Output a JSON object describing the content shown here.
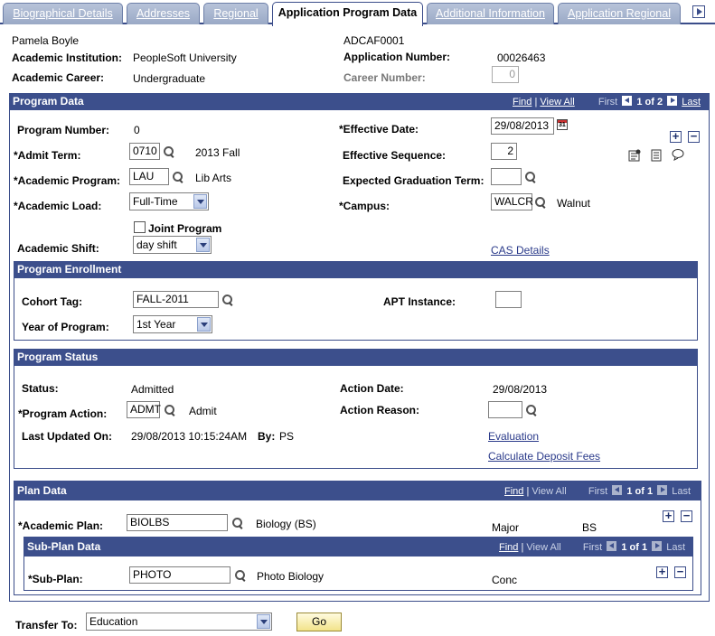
{
  "tabs": [
    {
      "label": "Biographical Details"
    },
    {
      "label": "Addresses"
    },
    {
      "label": "Regional"
    },
    {
      "label": "Application Program Data"
    },
    {
      "label": "Additional Information"
    },
    {
      "label": "Application Regional"
    }
  ],
  "header": {
    "name": "Pamela Boyle",
    "id": "ADCAF0001",
    "institution_label": "Academic Institution:",
    "institution_value": "PeopleSoft University",
    "app_number_label": "Application Number:",
    "app_number_value": "00026463",
    "career_label": "Academic Career:",
    "career_value": "Undergraduate",
    "career_number_label": "Career Number:",
    "career_number_value": "0"
  },
  "program_data": {
    "title": "Program Data",
    "nav": {
      "find": "Find",
      "view_all": "View All",
      "first": "First",
      "count": "1 of 2",
      "last": "Last"
    },
    "program_number_label": "Program Number:",
    "program_number_value": "0",
    "effective_date_label": "*Effective Date:",
    "effective_date_value": "29/08/2013",
    "admit_term_label": "*Admit Term:",
    "admit_term_value": "0710",
    "admit_term_desc": "2013 Fall",
    "effective_seq_label": "Effective Sequence:",
    "effective_seq_value": "2",
    "academic_program_label": "*Academic Program:",
    "academic_program_value": "LAU",
    "academic_program_desc": "Lib Arts",
    "exp_grad_label": "Expected Graduation Term:",
    "exp_grad_value": "",
    "academic_load_label": "*Academic Load:",
    "academic_load_value": "Full-Time",
    "campus_label": "*Campus:",
    "campus_value": "WALCR",
    "campus_desc": "Walnut",
    "joint_program_label": "Joint Program",
    "academic_shift_label": "Academic Shift:",
    "academic_shift_value": "day shift",
    "cas_details": "CAS Details"
  },
  "program_enrollment": {
    "title": "Program Enrollment",
    "cohort_tag_label": "Cohort Tag:",
    "cohort_tag_value": "FALL-2011",
    "apt_label": "APT Instance:",
    "apt_value": "",
    "year_label": "Year of Program:",
    "year_value": "1st Year"
  },
  "program_status": {
    "title": "Program Status",
    "status_label": "Status:",
    "status_value": "Admitted",
    "action_date_label": "Action Date:",
    "action_date_value": "29/08/2013",
    "program_action_label": "*Program Action:",
    "program_action_value": "ADMT",
    "program_action_desc": "Admit",
    "action_reason_label": "Action Reason:",
    "action_reason_value": "",
    "last_updated_label": "Last Updated On:",
    "last_updated_value": "29/08/2013 10:15:24AM",
    "by_label": "By:",
    "by_value": "PS",
    "evaluation": "Evaluation",
    "deposit_fees": "Calculate Deposit Fees"
  },
  "plan_data": {
    "title": "Plan Data",
    "nav": {
      "find": "Find",
      "view_all": "View All",
      "first": "First",
      "count": "1 of 1",
      "last": "Last"
    },
    "academic_plan_label": "*Academic Plan:",
    "academic_plan_value": "BIOLBS",
    "academic_plan_desc": "Biology (BS)",
    "plan_type": "Major",
    "degree": "BS"
  },
  "subplan_data": {
    "title": "Sub-Plan Data",
    "nav": {
      "find": "Find",
      "view_all": "View All",
      "first": "First",
      "count": "1 of 1",
      "last": "Last"
    },
    "subplan_label": "*Sub-Plan:",
    "subplan_value": "PHOTO",
    "subplan_desc": "Photo Biology",
    "subplan_type": "Conc"
  },
  "footer": {
    "transfer_label": "Transfer To:",
    "transfer_value": "Education",
    "go_label": "Go"
  }
}
